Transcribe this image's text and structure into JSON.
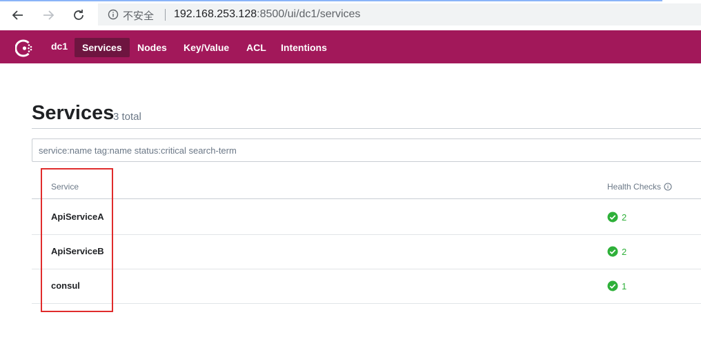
{
  "browser": {
    "insecure_label": "不安全",
    "url_host": "192.168.253.128",
    "url_path": ":8500/ui/dc1/services"
  },
  "header": {
    "datacenter": "dc1",
    "nav": [
      {
        "label": "Services",
        "active": true
      },
      {
        "label": "Nodes",
        "active": false
      },
      {
        "label": "Key/Value",
        "active": false
      },
      {
        "label": "ACL",
        "active": false
      },
      {
        "label": "Intentions",
        "active": false
      }
    ]
  },
  "page": {
    "title": "Services",
    "total": "3 total"
  },
  "search": {
    "placeholder": "service:name tag:name status:critical search-term"
  },
  "table": {
    "columns": {
      "service": "Service",
      "health": "Health Checks"
    },
    "rows": [
      {
        "name": "ApiServiceA",
        "passing": "2"
      },
      {
        "name": "ApiServiceB",
        "passing": "2"
      },
      {
        "name": "consul",
        "passing": "1"
      }
    ]
  },
  "colors": {
    "brand": "#a2185a",
    "brand_active": "#6e1540",
    "passing": "#2eb039",
    "annotation": "#e02b2b"
  }
}
